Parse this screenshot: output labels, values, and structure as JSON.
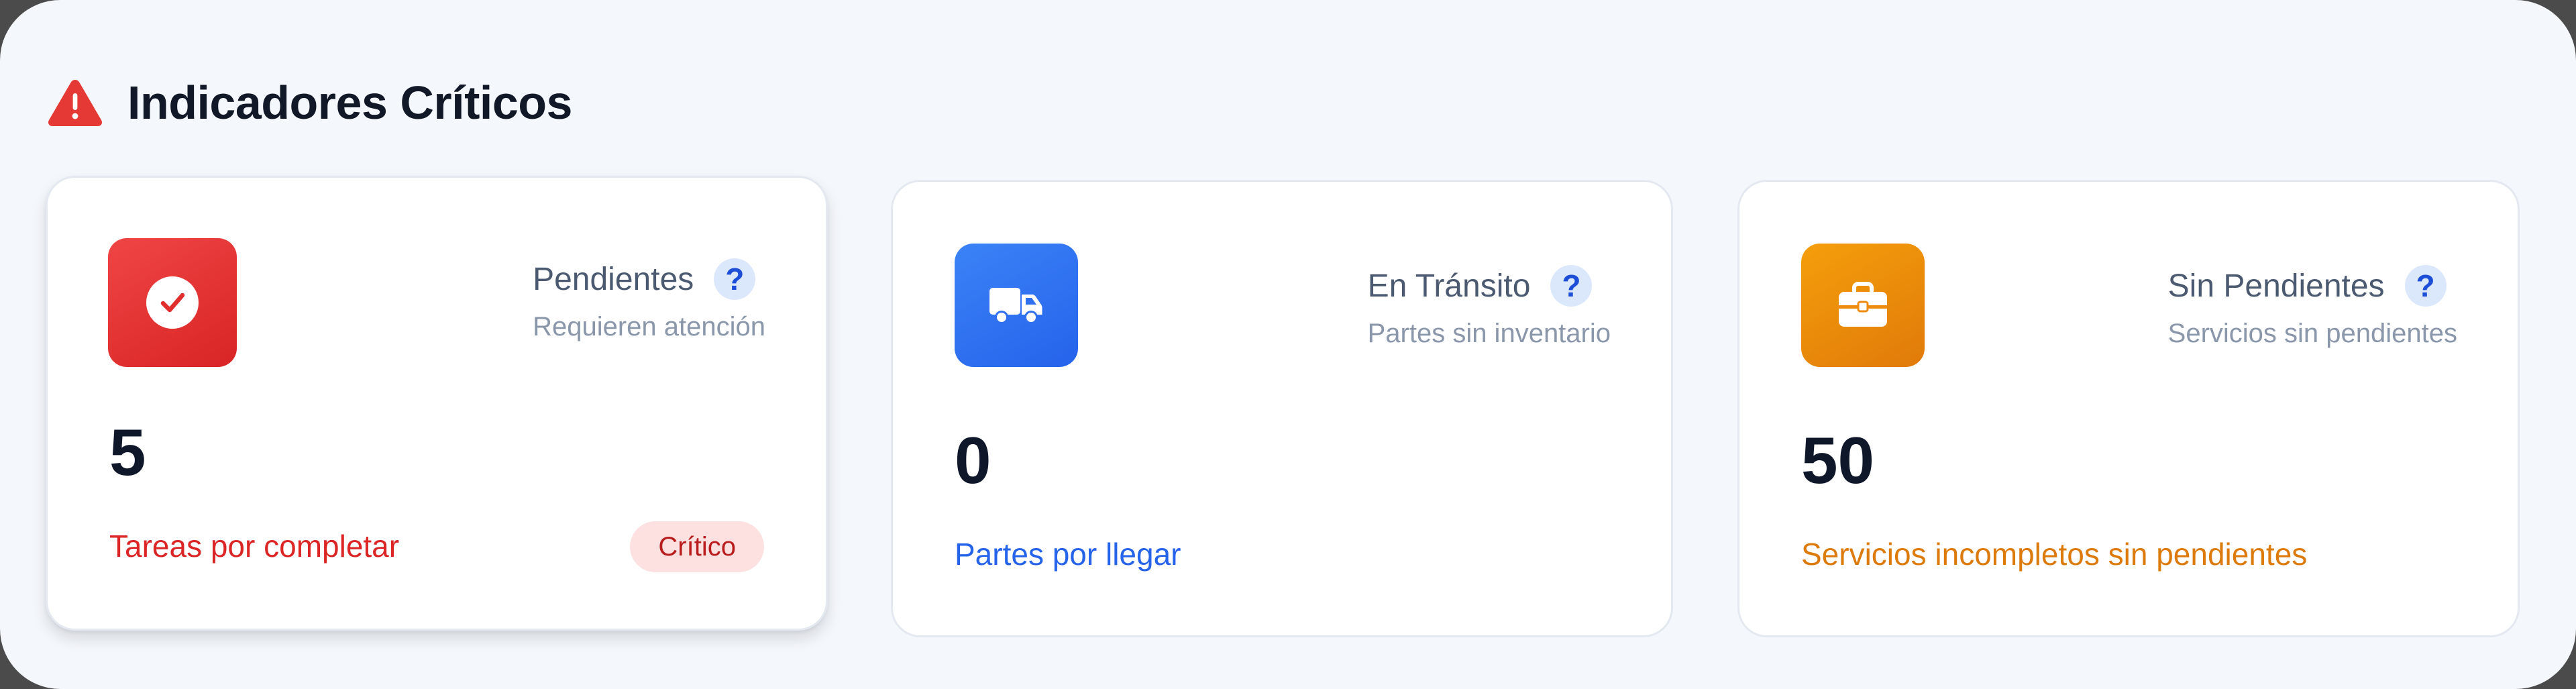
{
  "section": {
    "title": "Indicadores Críticos",
    "icon": "warning-triangle-icon",
    "icon_color": "#e53935"
  },
  "cards": [
    {
      "title": "Pendientes",
      "subtitle": "Requieren atención",
      "value": "5",
      "description": "Tareas por completar",
      "badge": "Crítico",
      "help": "?",
      "icon": "check-circle-icon",
      "accent": "#e02d2d",
      "description_color": "#dc2626"
    },
    {
      "title": "En Tránsito",
      "subtitle": "Partes sin inventario",
      "value": "0",
      "description": "Partes por llegar",
      "help": "?",
      "icon": "truck-icon",
      "accent": "#2f6ff0",
      "description_color": "#2563eb"
    },
    {
      "title": "Sin Pendientes",
      "subtitle": "Servicios sin pendientes",
      "value": "50",
      "description": "Servicios incompletos sin pendientes",
      "help": "?",
      "icon": "briefcase-icon",
      "accent": "#ee8a0c",
      "description_color": "#dd7a0c"
    }
  ]
}
